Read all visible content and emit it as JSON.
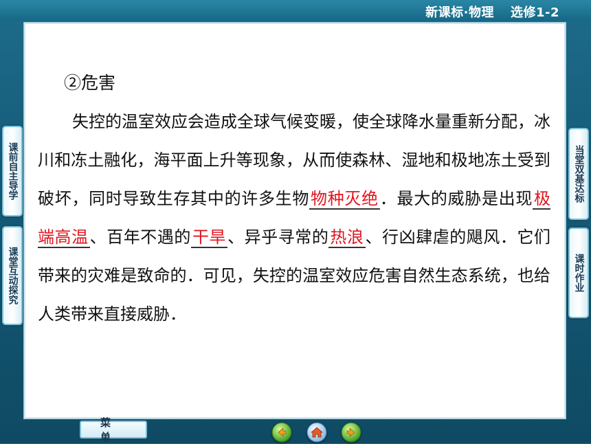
{
  "header": {
    "series": "新课标·物理",
    "volume": "选修1-2"
  },
  "content": {
    "heading": "②危害",
    "segments": [
      {
        "text": "失控的温室效应会造成全球气候变暖，使全球降水量重新分配，冰川和冻土融化，海平面上升等现象，从而使森林、湿地和极地冻土受到破坏，同时导致生存其中的许多生物",
        "blank": false
      },
      {
        "text": "物种灭绝",
        "blank": true
      },
      {
        "text": "．最大的威胁是出现",
        "blank": false
      },
      {
        "text": "极端高温",
        "blank": true
      },
      {
        "text": "、百年不遇的",
        "blank": false
      },
      {
        "text": "干旱",
        "blank": true
      },
      {
        "text": "、异乎寻常的",
        "blank": false
      },
      {
        "text": "热浪",
        "blank": true
      },
      {
        "text": "、行凶肆虐的飓风．它们带来的灾难是致命的．可见，失控的温室效应危害自然生态系统，也给人类带来直接威胁．",
        "blank": false
      }
    ]
  },
  "left_tabs": [
    {
      "label": "课前自主导学"
    },
    {
      "label": "课堂互动探究"
    }
  ],
  "right_tabs": [
    {
      "label": "当堂双基达标"
    },
    {
      "label": "课时作业"
    }
  ],
  "bottom": {
    "menu_label": "菜单",
    "nav_buttons": [
      {
        "icon": "back-arrow-icon",
        "color": "#f0a020"
      },
      {
        "icon": "home-icon",
        "color": "#3a7fd0"
      },
      {
        "icon": "forward-arrow-icon",
        "color": "#f0a020"
      }
    ]
  },
  "colors": {
    "background": "#155a76",
    "answer_text": "#e0161e"
  }
}
